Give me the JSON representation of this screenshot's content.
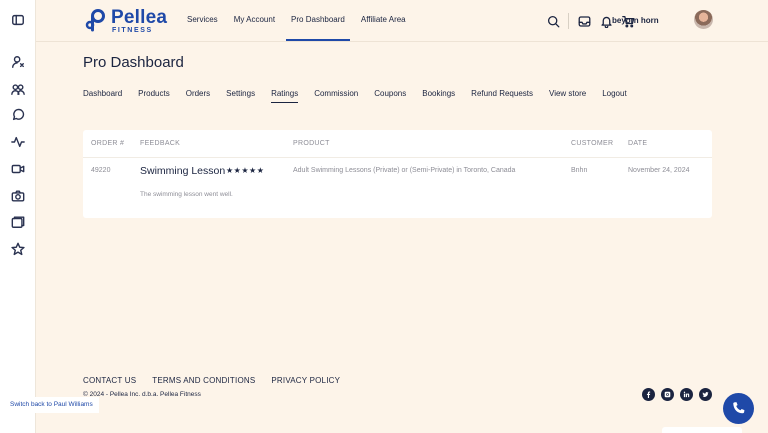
{
  "colors": {
    "background": "#fdf4e9",
    "brand": "#1f49a8",
    "text": "#1b2440",
    "muted": "#8d8d96",
    "card": "#ffffff"
  },
  "sidebar": {
    "icons": [
      "sidebar-toggle-icon",
      "user-icon",
      "users-icon",
      "chat-icon",
      "activity-icon",
      "video-icon",
      "camera-icon",
      "folders-icon",
      "star-icon"
    ]
  },
  "header": {
    "logo_name": "Pellea",
    "logo_sub": "FITNESS",
    "nav": [
      "Services",
      "My Account",
      "Pro Dashboard",
      "Affiliate Area"
    ],
    "active_nav": "Pro Dashboard",
    "icons": [
      "search-icon",
      "inbox-icon",
      "bell-icon",
      "cart-icon"
    ],
    "user_name": "beyorn horn"
  },
  "page": {
    "title": "Pro Dashboard",
    "tabs": [
      "Dashboard",
      "Products",
      "Orders",
      "Settings",
      "Ratings",
      "Commission",
      "Coupons",
      "Bookings",
      "Refund Requests",
      "View store",
      "Logout"
    ],
    "active_tab": "Ratings"
  },
  "ratings_table": {
    "headers": {
      "order": "ORDER #",
      "feedback": "FEEDBACK",
      "product": "PRODUCT",
      "customer": "CUSTOMER",
      "date": "DATE"
    },
    "rows": [
      {
        "order": "49220",
        "feedback_title": "Swimming Lesson",
        "stars": "★★★★★",
        "rating": 5,
        "feedback_text": "The swimming lesson went well.",
        "product": "Adult Swimming Lessons (Private) or (Semi-Private) in Toronto, Canada",
        "customer": "Bnhn",
        "date": "November 24, 2024"
      }
    ]
  },
  "footer": {
    "links": [
      "CONTACT US",
      "TERMS AND CONDITIONS",
      "PRIVACY POLICY"
    ],
    "copyright": "© 2024 - Pellea Inc. d.b.a. Pellea Fitness",
    "socials": [
      "facebook-icon",
      "instagram-icon",
      "linkedin-icon",
      "twitter-icon"
    ],
    "switch_back": "Switch back to Paul Williams"
  }
}
